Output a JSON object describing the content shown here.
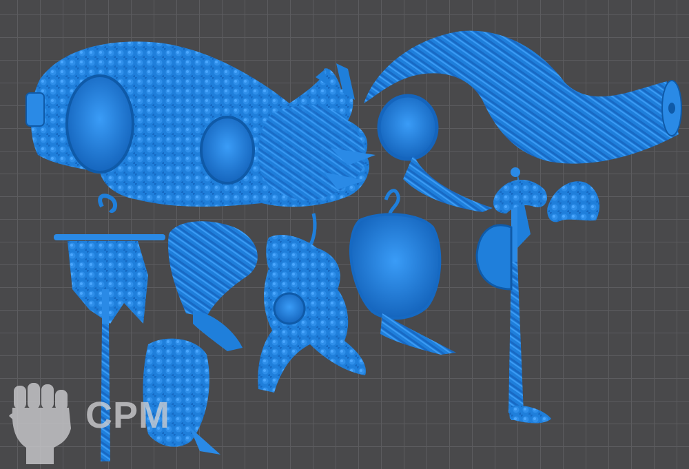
{
  "viewport": {
    "background": "#49494b",
    "grid_color": "#5c5c5f",
    "model_color": "#1f7fdb",
    "model_shadow": "#0f5aa8",
    "model_highlight": "#46a6ff"
  },
  "watermark": {
    "text": "CPM",
    "logo_icon": "raised-fist-icon",
    "color": "#cfcfd2"
  },
  "parts": [
    "serpent-body-head-part",
    "serpent-tail-part",
    "serpent-tail-tip-part",
    "banner-standard-part",
    "rider-torso-part",
    "rider-figure-part",
    "rider-cloak-part",
    "axe-weapon-part",
    "fin-ornament-part"
  ]
}
